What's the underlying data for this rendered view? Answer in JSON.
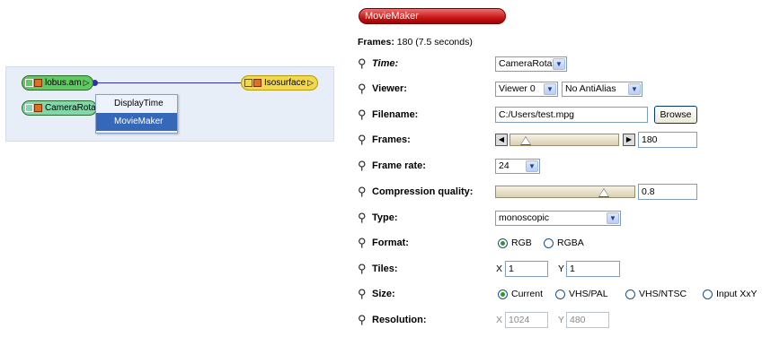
{
  "pool": {
    "nodes": [
      {
        "label": "lobus.am"
      },
      {
        "label": "CameraRotate"
      },
      {
        "label": "Isosurface"
      }
    ],
    "popup_items": [
      "DisplayTime",
      "MovieMaker"
    ]
  },
  "panel": {
    "title": "MovieMaker",
    "frames_info_label": "Frames:",
    "frames_info_value": "180 (7.5 seconds)",
    "time_label": "Time:",
    "time_value": "CameraRotate",
    "viewer_label": "Viewer:",
    "viewer_value": "Viewer 0",
    "antialias_value": "No AntiAlias",
    "filename_label": "Filename:",
    "filename_value": "C:/Users/test.mpg",
    "browse_label": "Browse",
    "frames_label": "Frames:",
    "frames_value": "180",
    "framerate_label": "Frame rate:",
    "framerate_value": "24",
    "compression_label": "Compression quality:",
    "compression_value": "0.8",
    "compression_level": 0.8,
    "type_label": "Type:",
    "type_value": "monoscopic",
    "format_label": "Format:",
    "format_options": [
      "RGB",
      "RGBA"
    ],
    "tiles_label": "Tiles:",
    "tiles_x_label": "X",
    "tiles_x": "1",
    "tiles_y_label": "Y",
    "tiles_y": "1",
    "size_label": "Size:",
    "size_options": [
      "Current",
      "VHS/PAL",
      "VHS/NTSC",
      "Input XxY"
    ],
    "resolution_label": "Resolution:",
    "resolution_x_label": "X",
    "resolution_x": "1024",
    "resolution_y_label": "Y",
    "resolution_y": "480"
  },
  "colors": {
    "title_red": "#c81818",
    "pool_bg": "#e8eef8",
    "menu_selected": "#3568b8",
    "connection": "#2f2fb0"
  },
  "icons": {
    "pin": "pin-icon",
    "dropdown": "chevron-down-icon"
  }
}
